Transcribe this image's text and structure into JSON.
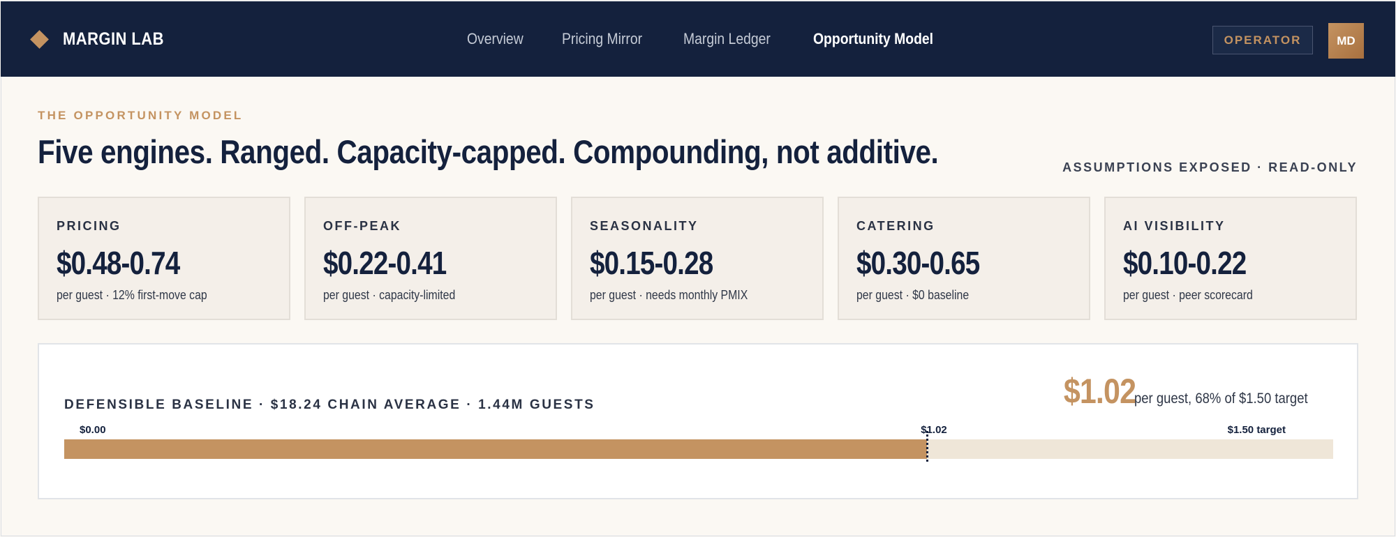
{
  "app": {
    "brand": "MARGIN LAB",
    "nav": [
      "Overview",
      "Pricing Mirror",
      "Margin Ledger",
      "Opportunity Model"
    ],
    "active_nav": "Opportunity Model",
    "operator_label": "OPERATOR",
    "avatar_initials": "MD",
    "accent_color": "#c49361",
    "navy_color": "#14213d"
  },
  "header": {
    "eyebrow": "THE OPPORTUNITY MODEL",
    "headline": "Five engines. Ranged. Capacity-capped. Compounding, not additive.",
    "assumptions": "ASSUMPTIONS EXPOSED · READ-ONLY"
  },
  "cards": [
    {
      "label": "PRICING",
      "value": "$0.48-0.74",
      "sub": "per guest · 12% first-move cap"
    },
    {
      "label": "OFF-PEAK",
      "value": "$0.22-0.41",
      "sub": "per guest · capacity-limited"
    },
    {
      "label": "SEASONALITY",
      "value": "$0.15-0.28",
      "sub": "per guest · needs monthly PMIX"
    },
    {
      "label": "CATERING",
      "value": "$0.30-0.65",
      "sub": "per guest · $0 baseline"
    },
    {
      "label": "AI VISIBILITY",
      "value": "$0.10-0.22",
      "sub": "per guest · peer scorecard"
    }
  ],
  "baseline": {
    "title": "DEFENSIBLE BASELINE · $18.24 CHAIN AVERAGE · 1.44M GUESTS",
    "kpi_value": "$1.02",
    "kpi_note": "per guest, 68% of $1.50 target",
    "progress": {
      "min": 0,
      "max": 1.5,
      "current": 1.02,
      "min_label": "$0.00",
      "current_label": "$1.02",
      "target_label": "$1.50 target"
    }
  }
}
